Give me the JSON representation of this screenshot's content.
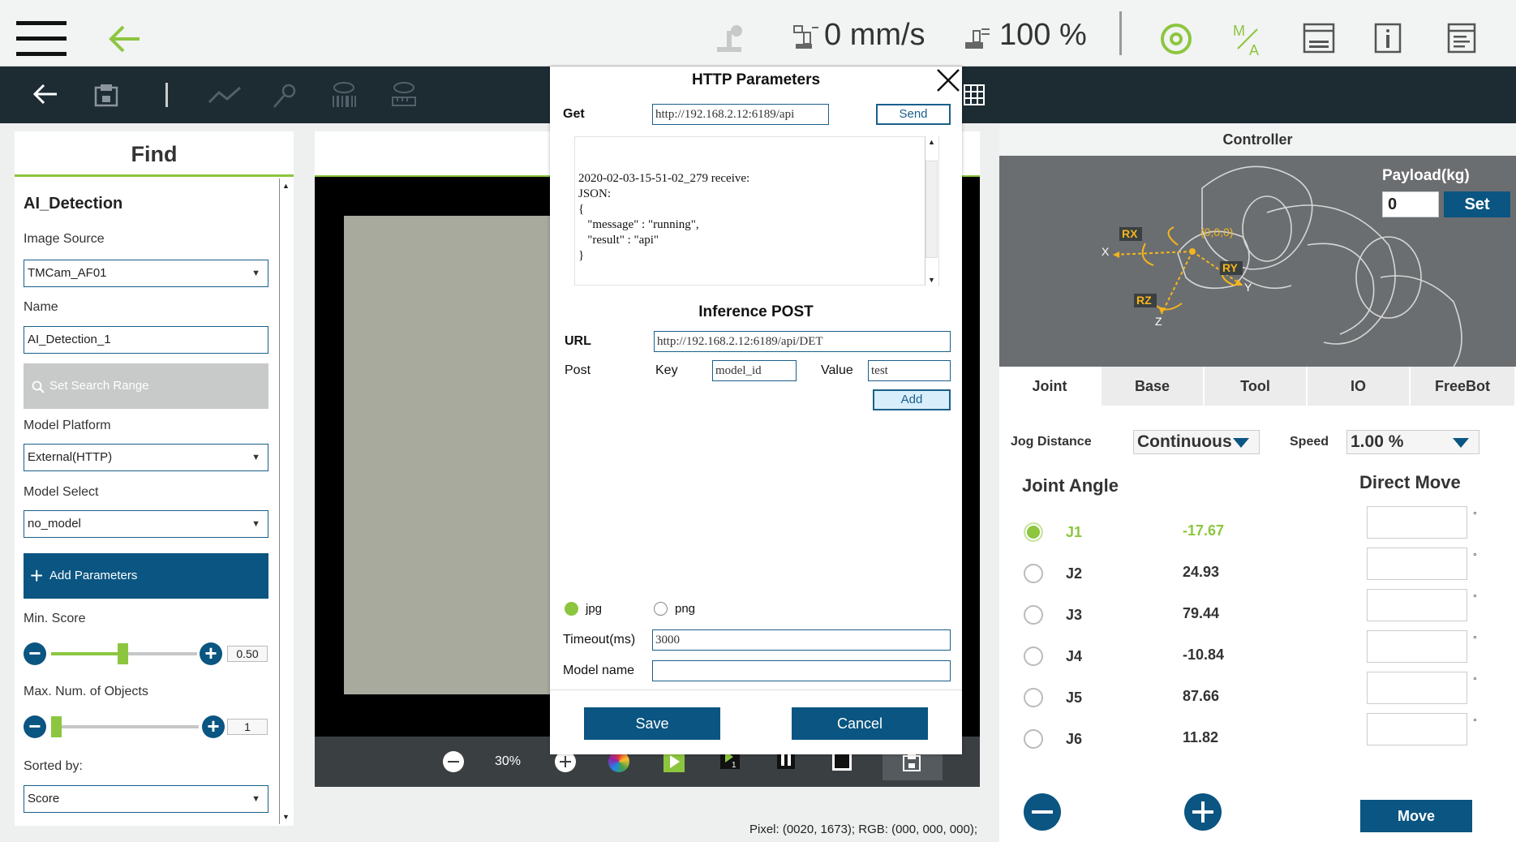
{
  "topbar": {
    "speed_value": "0 mm/s",
    "percent_value": "100 %"
  },
  "find": {
    "header": "Find",
    "section_title": "AI_Detection",
    "image_source_label": "Image Source",
    "image_source_value": "TMCam_AF01",
    "name_label": "Name",
    "name_value": "AI_Detection_1",
    "set_search_range": "Set Search Range",
    "model_platform_label": "Model Platform",
    "model_platform_value": "External(HTTP)",
    "model_select_label": "Model Select",
    "model_select_value": "no_model",
    "add_parameters": "Add Parameters",
    "min_score_label": "Min. Score",
    "min_score_value": "0.50",
    "min_score_fraction": 0.5,
    "max_objects_label": "Max. Num. of Objects",
    "max_objects_value": "1",
    "sorted_by_label": "Sorted by:",
    "sorted_by_value": "Score"
  },
  "camera": {
    "zoom": "30%",
    "status": "Pixel: (0020, 1673); RGB: (000, 000, 000);"
  },
  "dialog": {
    "title": "HTTP Parameters",
    "get_label": "Get",
    "get_url": "http://192.168.2.12:6189/api",
    "send_button": "Send",
    "response_text": "2020-02-03-15-51-02_279 receive:\nJSON:\n{\n   \"message\" : \"running\",\n   \"result\" : \"api\"\n}",
    "inference_title": "Inference POST",
    "url_label": "URL",
    "post_url": "http://192.168.2.12:6189/api/DET",
    "post_label": "Post",
    "key_label": "Key",
    "key_value": "model_id",
    "value_label": "Value",
    "value_value": "test",
    "add_button": "Add",
    "format_jpg": "jpg",
    "format_png": "png",
    "selected_format": "jpg",
    "timeout_label": "Timeout(ms)",
    "timeout_value": "3000",
    "model_name_label": "Model name",
    "model_name_value": "",
    "save_button": "Save",
    "cancel_button": "Cancel"
  },
  "controller": {
    "title": "Controller",
    "payload_label": "Payload(kg)",
    "payload_value": "0",
    "payload_set": "Set",
    "robot_labels": {
      "rx": "RX",
      "ry": "RY",
      "rz": "RZ",
      "x": "X",
      "y": "Y",
      "z": "Z",
      "origin": "(0,0,0)"
    },
    "tabs": [
      "Joint",
      "Base",
      "Tool",
      "IO",
      "FreeBot"
    ],
    "jog_distance_label": "Jog Distance",
    "jog_distance_value": "Continuous",
    "speed_label": "Speed",
    "speed_value": "1.00 %",
    "joint_angle_label": "Joint Angle",
    "direct_move_label": "Direct Move",
    "degree_symbol": "°",
    "joints": [
      {
        "name": "J1",
        "value": "-17.67",
        "selected": true
      },
      {
        "name": "J2",
        "value": "24.93",
        "selected": false
      },
      {
        "name": "J3",
        "value": "79.44",
        "selected": false
      },
      {
        "name": "J4",
        "value": "-10.84",
        "selected": false
      },
      {
        "name": "J5",
        "value": "87.66",
        "selected": false
      },
      {
        "name": "J6",
        "value": "11.82",
        "selected": false
      }
    ],
    "move_button": "Move"
  },
  "colors": {
    "accent_green": "#8cc63f",
    "primary_blue": "#0a5581",
    "toolbar_dark": "#1d2b33",
    "label_orange": "#f5b51b"
  }
}
